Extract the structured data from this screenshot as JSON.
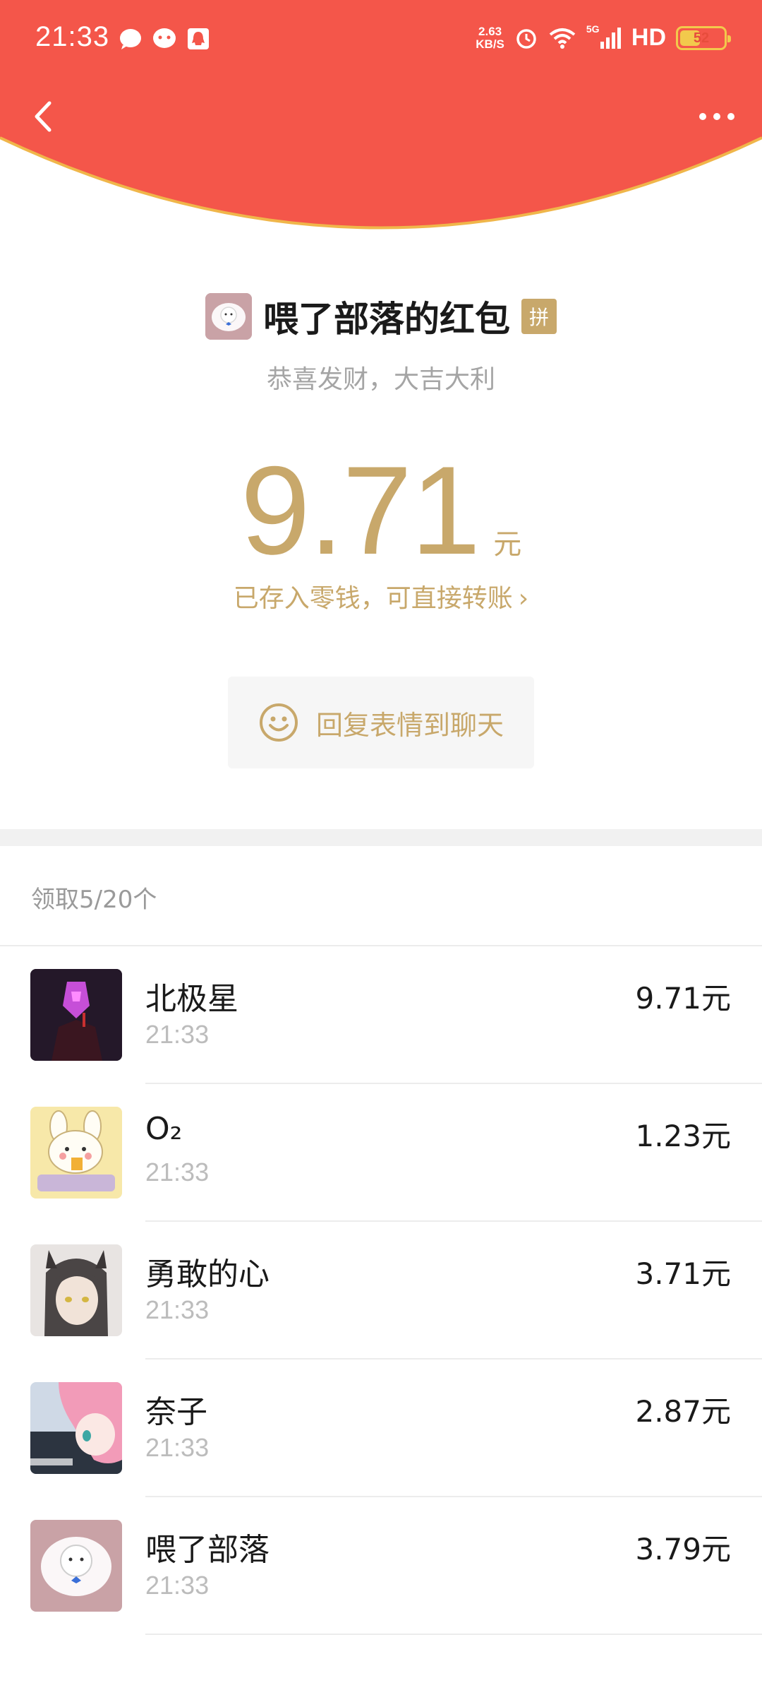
{
  "status_bar": {
    "time": "21:33",
    "net_speed_value": "2.63",
    "net_speed_unit": "KB/S",
    "network_type": "5G",
    "hd": "HD",
    "battery_level": "52",
    "battery_fraction": 0.52,
    "left_icons": [
      "message-bubble-icon",
      "wechat-icon",
      "qq-icon"
    ],
    "right_icons": [
      "alarm-icon",
      "wifi-icon",
      "signal-icon"
    ]
  },
  "colors": {
    "header_red": "#f4564a",
    "gold_border": "#f0b64a",
    "accent_gold": "#c8a86b"
  },
  "nav": {
    "back_icon": "chevron-left-icon",
    "more_icon": "more-dots-icon"
  },
  "packet": {
    "title": "喂了部落的红包",
    "badge": "拼",
    "blessing": "恭喜发财，大吉大利",
    "amount": "9.71",
    "unit": "元",
    "wallet_note": "已存入零钱，可直接转账",
    "wallet_chevron": "›",
    "reply_label": "回复表情到聊天",
    "reply_icon": "smiley-icon"
  },
  "claims": {
    "summary": "领取5/20个",
    "items": [
      {
        "name": "北极星",
        "time": "21:33",
        "amount": "9.71元"
      },
      {
        "name": "O₂",
        "time": "21:33",
        "amount": "1.23元"
      },
      {
        "name": "勇敢的心",
        "time": "21:33",
        "amount": "3.71元"
      },
      {
        "name": "奈子",
        "time": "21:33",
        "amount": "2.87元"
      },
      {
        "name": "喂了部落",
        "time": "21:33",
        "amount": "3.79元"
      }
    ]
  }
}
